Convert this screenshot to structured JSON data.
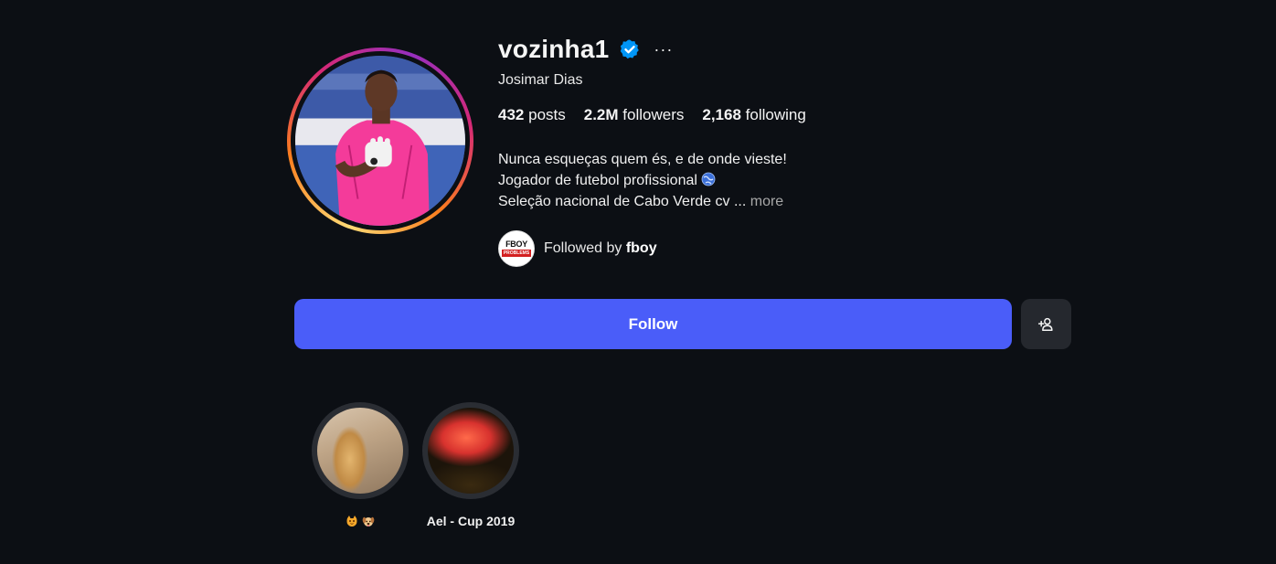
{
  "profile": {
    "username": "vozinha1",
    "full_name": "Josimar Dias",
    "verified": true,
    "stats": {
      "posts_count": "432",
      "posts_label": "posts",
      "followers_count": "2.2M",
      "followers_label": "followers",
      "following_count": "2,168",
      "following_label": "following"
    },
    "bio": {
      "line1": "Nunca esqueças quem és, e de onde vieste!",
      "line2": "Jogador de futebol profissional",
      "line3": "Seleção nacional de Cabo Verde cv ...",
      "more_label": "more"
    },
    "followed_by": {
      "prefix": "Followed by",
      "user": "fboy",
      "avatar_text_top": "FBOY",
      "avatar_text_bottom": "PROBLEMS"
    }
  },
  "actions": {
    "follow_label": "Follow"
  },
  "highlights": [
    {
      "label": ""
    },
    {
      "label": "Ael - Cup 2019"
    }
  ],
  "colors": {
    "background": "#0c0f14",
    "follow_button": "#4a5df9",
    "secondary_button": "#25282e",
    "verified_badge": "#0095f6",
    "muted_text": "#a8a8a8"
  },
  "icons": [
    "verified-badge-icon",
    "more-options-icon",
    "globe-icon",
    "add-person-icon"
  ]
}
